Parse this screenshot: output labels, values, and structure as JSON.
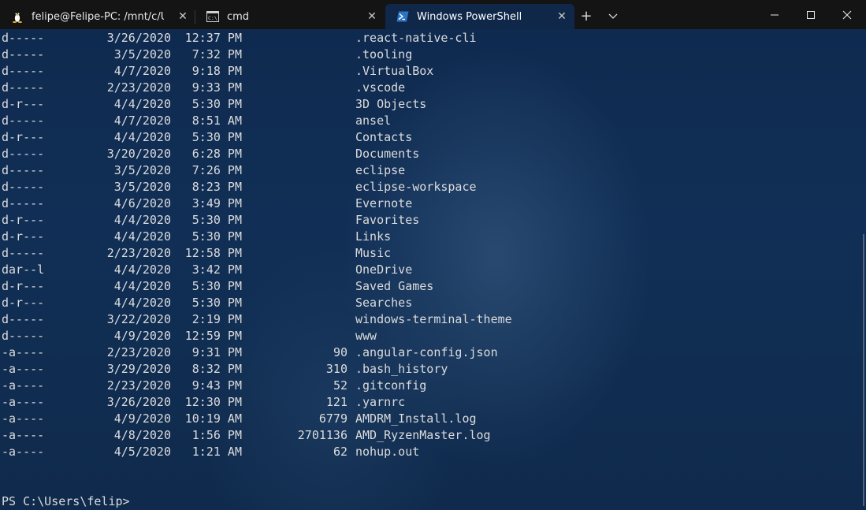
{
  "tabs": [
    {
      "title": "felipe@Felipe-PC: /mnt/c/Users/",
      "icon": "linux-penguin-icon"
    },
    {
      "title": "cmd",
      "icon": "cmd-icon"
    },
    {
      "title": "Windows PowerShell",
      "icon": "powershell-icon"
    }
  ],
  "tab_close": "✕",
  "new_tab": "+",
  "colors": {
    "tabbar": "#141414",
    "active_tab": "#0f2849",
    "terminal_bg": "#0f2a4f",
    "text": "#dcdcdc"
  },
  "listing": [
    {
      "mode": "d-----",
      "date": "3/26/2020",
      "time": "12:37 PM",
      "length": "",
      "name": ".react-native-cli"
    },
    {
      "mode": "d-----",
      "date": "3/5/2020",
      "time": "7:32 PM",
      "length": "",
      "name": ".tooling"
    },
    {
      "mode": "d-----",
      "date": "4/7/2020",
      "time": "9:18 PM",
      "length": "",
      "name": ".VirtualBox"
    },
    {
      "mode": "d-----",
      "date": "2/23/2020",
      "time": "9:33 PM",
      "length": "",
      "name": ".vscode"
    },
    {
      "mode": "d-r---",
      "date": "4/4/2020",
      "time": "5:30 PM",
      "length": "",
      "name": "3D Objects"
    },
    {
      "mode": "d-----",
      "date": "4/7/2020",
      "time": "8:51 AM",
      "length": "",
      "name": "ansel"
    },
    {
      "mode": "d-r---",
      "date": "4/4/2020",
      "time": "5:30 PM",
      "length": "",
      "name": "Contacts"
    },
    {
      "mode": "d-----",
      "date": "3/20/2020",
      "time": "6:28 PM",
      "length": "",
      "name": "Documents"
    },
    {
      "mode": "d-----",
      "date": "3/5/2020",
      "time": "7:26 PM",
      "length": "",
      "name": "eclipse"
    },
    {
      "mode": "d-----",
      "date": "3/5/2020",
      "time": "8:23 PM",
      "length": "",
      "name": "eclipse-workspace"
    },
    {
      "mode": "d-----",
      "date": "4/6/2020",
      "time": "3:49 PM",
      "length": "",
      "name": "Evernote"
    },
    {
      "mode": "d-r---",
      "date": "4/4/2020",
      "time": "5:30 PM",
      "length": "",
      "name": "Favorites"
    },
    {
      "mode": "d-r---",
      "date": "4/4/2020",
      "time": "5:30 PM",
      "length": "",
      "name": "Links"
    },
    {
      "mode": "d-----",
      "date": "2/23/2020",
      "time": "12:58 PM",
      "length": "",
      "name": "Music"
    },
    {
      "mode": "dar--l",
      "date": "4/4/2020",
      "time": "3:42 PM",
      "length": "",
      "name": "OneDrive"
    },
    {
      "mode": "d-r---",
      "date": "4/4/2020",
      "time": "5:30 PM",
      "length": "",
      "name": "Saved Games"
    },
    {
      "mode": "d-r---",
      "date": "4/4/2020",
      "time": "5:30 PM",
      "length": "",
      "name": "Searches"
    },
    {
      "mode": "d-----",
      "date": "3/22/2020",
      "time": "2:19 PM",
      "length": "",
      "name": "windows-terminal-theme"
    },
    {
      "mode": "d-----",
      "date": "4/9/2020",
      "time": "12:59 PM",
      "length": "",
      "name": "www"
    },
    {
      "mode": "-a----",
      "date": "2/23/2020",
      "time": "9:31 PM",
      "length": "90",
      "name": ".angular-config.json"
    },
    {
      "mode": "-a----",
      "date": "3/29/2020",
      "time": "8:32 PM",
      "length": "310",
      "name": ".bash_history"
    },
    {
      "mode": "-a----",
      "date": "2/23/2020",
      "time": "9:43 PM",
      "length": "52",
      "name": ".gitconfig"
    },
    {
      "mode": "-a----",
      "date": "3/26/2020",
      "time": "12:30 PM",
      "length": "121",
      "name": ".yarnrc"
    },
    {
      "mode": "-a----",
      "date": "4/9/2020",
      "time": "10:19 AM",
      "length": "6779",
      "name": "AMDRM_Install.log"
    },
    {
      "mode": "-a----",
      "date": "4/8/2020",
      "time": "1:56 PM",
      "length": "2701136",
      "name": "AMD_RyzenMaster.log"
    },
    {
      "mode": "-a----",
      "date": "4/5/2020",
      "time": "1:21 AM",
      "length": "62",
      "name": "nohup.out"
    }
  ],
  "prompt": "PS C:\\Users\\felip>"
}
